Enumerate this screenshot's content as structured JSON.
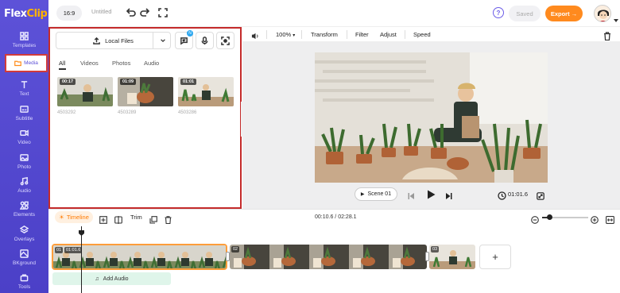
{
  "app": {
    "logo_flex": "Flex",
    "logo_clip": "Clip"
  },
  "sidebar": {
    "items": [
      {
        "label": "Templates",
        "icon": "templates-icon"
      },
      {
        "label": "Media",
        "icon": "media-icon",
        "active": true
      },
      {
        "label": "Text",
        "icon": "text-icon"
      },
      {
        "label": "Subtitle",
        "icon": "subtitle-icon"
      },
      {
        "label": "Video",
        "icon": "video-icon"
      },
      {
        "label": "Photo",
        "icon": "photo-icon"
      },
      {
        "label": "Audio",
        "icon": "audio-icon"
      },
      {
        "label": "Elements",
        "icon": "elements-icon"
      },
      {
        "label": "Overlays",
        "icon": "overlays-icon"
      },
      {
        "label": "BKground",
        "icon": "background-icon"
      },
      {
        "label": "Tools",
        "icon": "tools-icon"
      }
    ]
  },
  "topbar": {
    "ratio": "16:9",
    "title": "Untitled",
    "saved": "Saved",
    "export": "Export →",
    "help": "?"
  },
  "media": {
    "local_files": "Local Files",
    "badge": "N",
    "tabs": [
      "All",
      "Videos",
      "Photos",
      "Audio"
    ],
    "items": [
      {
        "duration": "00:17",
        "id": "4503292"
      },
      {
        "duration": "01:09",
        "id": "4503289"
      },
      {
        "duration": "01:01",
        "id": "4503286"
      }
    ]
  },
  "edit_toolbar": {
    "zoom": "100%",
    "transform": "Transform",
    "filter": "Filter",
    "adjust": "Adjust",
    "speed": "Speed"
  },
  "player": {
    "scene": "Scene 01",
    "duration": "01:01.6"
  },
  "timeline": {
    "label": "Timeline",
    "trim": "Trim",
    "time": "00:10.6 / 02:28.1",
    "add_audio": "Add Audio",
    "add_clip": "+",
    "clips": [
      {
        "index": "01",
        "duration": "01:01.6"
      },
      {
        "index": "02"
      },
      {
        "index": "03"
      }
    ]
  },
  "colors": {
    "sidebar": "#5b4fd6",
    "accent": "#ff8a1e",
    "highlight": "#c42b2b"
  }
}
